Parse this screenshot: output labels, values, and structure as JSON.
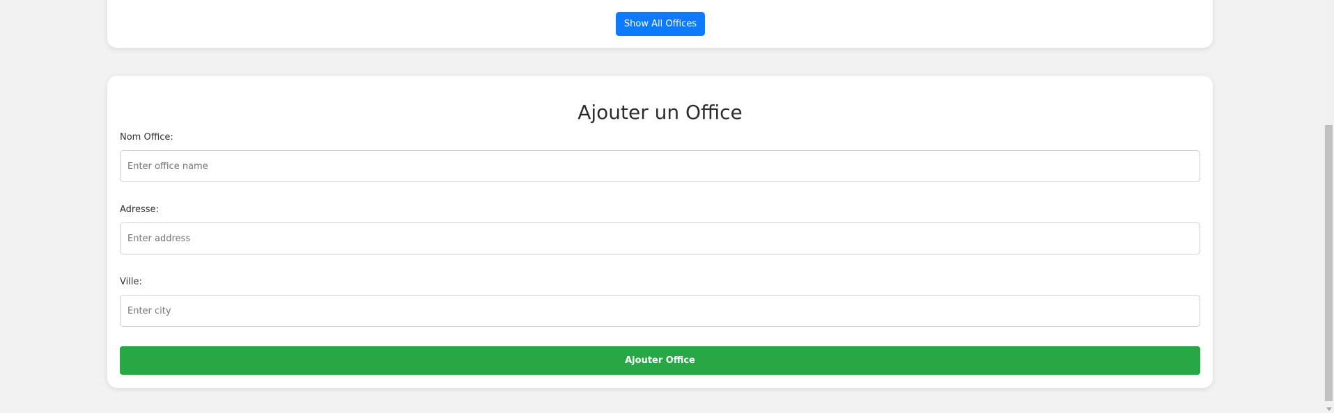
{
  "top_section": {
    "show_all_label": "Show All Offices"
  },
  "form": {
    "title": "Ajouter un Office",
    "fields": [
      {
        "label": "Nom Office:",
        "placeholder": "Enter office name",
        "value": ""
      },
      {
        "label": "Adresse:",
        "placeholder": "Enter address",
        "value": ""
      },
      {
        "label": "Ville:",
        "placeholder": "Enter city",
        "value": ""
      }
    ],
    "submit_label": "Ajouter Office"
  },
  "colors": {
    "background": "#f2f2f2",
    "primary_button": "#0d7bff",
    "submit_button": "#28a745"
  }
}
